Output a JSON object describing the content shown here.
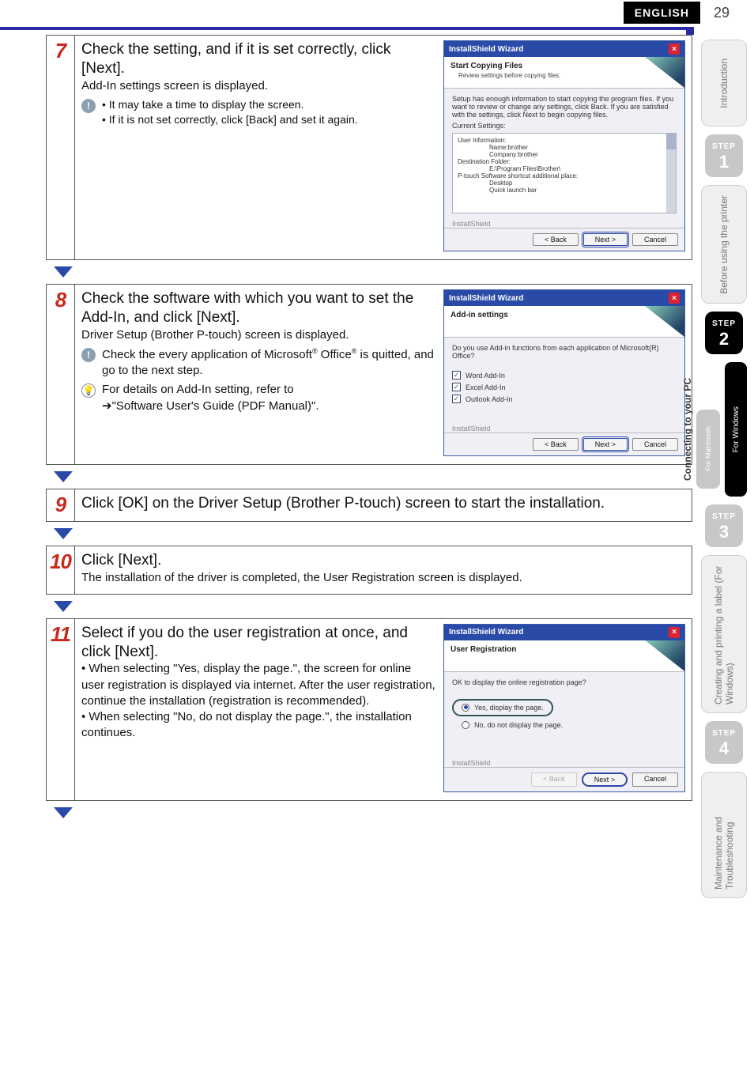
{
  "header": {
    "language": "ENGLISH",
    "page": "29"
  },
  "nav": {
    "introduction": "Introduction",
    "before": "Before using the printer",
    "connecting_title": "Connecting to your PC",
    "for_windows": "For Windows",
    "for_mac": "For Macintosh",
    "printing": "Creating and printing a label (For Windows)",
    "maintenance": "Maintenance and Troubleshooting",
    "steps": {
      "s1": "1",
      "s2": "2",
      "s3": "3",
      "s4": "4",
      "lbl": "STEP"
    }
  },
  "step7": {
    "num": "7",
    "title1": "Check the setting, and if it is set correctly, click [Next].",
    "sub": "Add-In settings screen is displayed.",
    "b1": "• It may take a time to display the screen.",
    "b2": "• If it is not set correctly, click [Back] and set it again."
  },
  "step8": {
    "num": "8",
    "title1": "Check the software with which you want to set the Add-In, and click [Next].",
    "sub": "Driver Setup (Brother P-touch) screen is displayed.",
    "note1a": "Check the every application of Microsoft",
    "note1b": " Office",
    "note1c": " is quitted, and go to the next step.",
    "note2a": "For details on Add-In setting, refer to",
    "note2b": "➔\"Software User's Guide (PDF Manual)\"."
  },
  "step9": {
    "num": "9",
    "text": "Click [OK] on the Driver Setup (Brother P-touch) screen to start the installation."
  },
  "step10": {
    "num": "10",
    "title": "Click [Next].",
    "sub": "The installation of the driver is completed, the User Registration screen is displayed."
  },
  "step11": {
    "num": "11",
    "title": "Select if you do the user registration at once, and click [Next].",
    "b1": "• When selecting \"Yes, display the page.\", the screen for online user registration is displayed via internet. After the user registration, continue the installation (registration is recommended).",
    "b2": "• When selecting \"No, do not display the page.\", the installation continues."
  },
  "wiz7": {
    "title": "InstallShield Wizard",
    "h1": "Start Copying Files",
    "h2": "Review settings before copying files.",
    "desc": "Setup has enough information to start copying the program files. If you want to review or change any settings, click Back. If you are satisfied with the settings, click Next to begin copying files.",
    "cur": "Current Settings:",
    "ui": "User Information:",
    "name": "Name:brother",
    "comp": "Company:brother",
    "df": "Destination Folder:",
    "dfv": "E:\\Program Files\\Brother\\",
    "ps": "P-touch Software shortcut additional place:",
    "psa": "Desktop",
    "psb": "Quick launch bar",
    "inst": "InstallShield",
    "back": "< Back",
    "next": "Next >",
    "cancel": "Cancel"
  },
  "wiz8": {
    "title": "InstallShield Wizard",
    "h1": "Add-in settings",
    "desc": "Do you use Add-in functions from each application of Microsoft(R) Office?",
    "c1": "Word Add-In",
    "c2": "Excel Add-In",
    "c3": "Outlook Add-In",
    "inst": "InstallShield",
    "back": "< Back",
    "next": "Next >",
    "cancel": "Cancel"
  },
  "wiz11": {
    "title": "InstallShield Wizard",
    "h1": "User Registration",
    "desc": "OK to display the online registration page?",
    "r1": "Yes, display the page.",
    "r2": "No, do not display the page.",
    "inst": "InstallShield",
    "back": "< Back",
    "next": "Next >",
    "cancel": "Cancel"
  }
}
